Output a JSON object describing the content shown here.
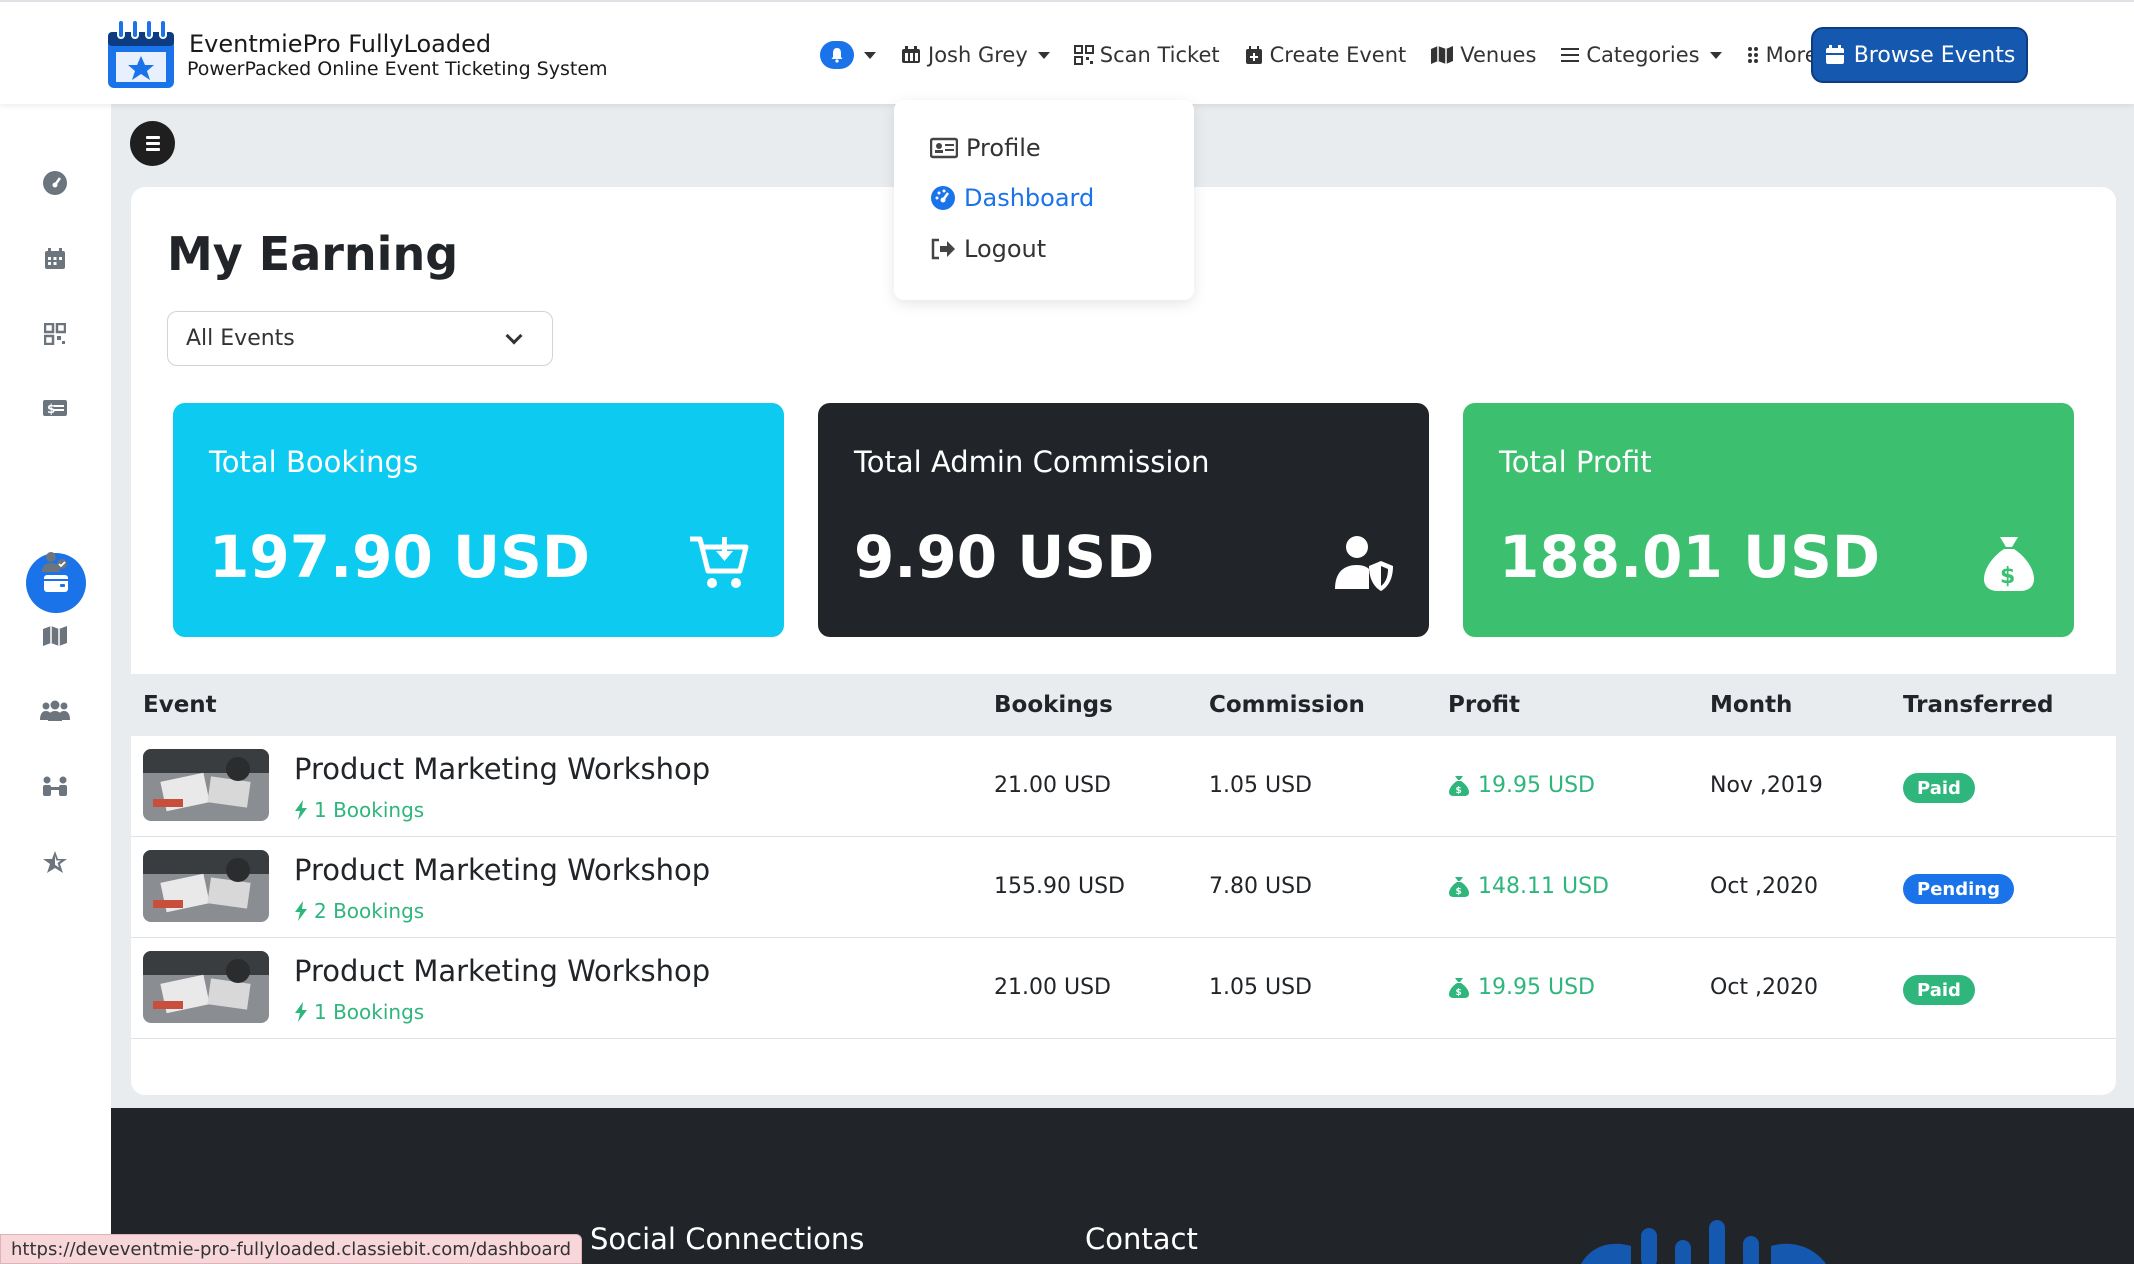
{
  "brand": {
    "title": "EventmiePro FullyLoaded",
    "subtitle": "PowerPacked Online Event Ticketing System"
  },
  "nav": {
    "user": "Josh Grey",
    "scan": "Scan Ticket",
    "create": "Create Event",
    "venues": "Venues",
    "categories": "Categories",
    "more": "More",
    "browse": "Browse Events"
  },
  "dropdown": {
    "items": [
      "Profile",
      "Dashboard",
      "Logout"
    ]
  },
  "page": {
    "title": "My Earning",
    "filter": "All Events"
  },
  "stats": [
    {
      "label": "Total Bookings",
      "value": "197.90 USD",
      "color": "#0dcaf0",
      "icon": "cart-icon"
    },
    {
      "label": "Total Admin Commission",
      "value": "9.90 USD",
      "color": "#212529",
      "icon": "admin-shield-icon"
    },
    {
      "label": "Total Profit",
      "value": "188.01 USD",
      "color": "#3cc06f",
      "icon": "money-bag-icon"
    }
  ],
  "table": {
    "headers": [
      "Event",
      "Bookings",
      "Commission",
      "Profit",
      "Month",
      "Transferred"
    ],
    "rows": [
      {
        "event": "Product Marketing Workshop",
        "bookings_count": "1 Bookings",
        "bookings": "21.00 USD",
        "commission": "1.05 USD",
        "profit": "19.95 USD",
        "month": "Nov ,2019",
        "status": "Paid"
      },
      {
        "event": "Product Marketing Workshop",
        "bookings_count": "2 Bookings",
        "bookings": "155.90 USD",
        "commission": "7.80 USD",
        "profit": "148.11 USD",
        "month": "Oct ,2020",
        "status": "Pending"
      },
      {
        "event": "Product Marketing Workshop",
        "bookings_count": "1 Bookings",
        "bookings": "21.00 USD",
        "commission": "1.05 USD",
        "profit": "19.95 USD",
        "month": "Oct ,2020",
        "status": "Paid"
      }
    ]
  },
  "footer": {
    "headings": [
      "Social Connections",
      "Contact"
    ]
  },
  "statusbar": "https://deveventmie-pro-fullyloaded.classiebit.com/dashboard",
  "colors": {
    "primary": "#1a73e8",
    "success": "#2eb67d",
    "paid": "#2eb67d",
    "pending": "#1a73e8"
  }
}
